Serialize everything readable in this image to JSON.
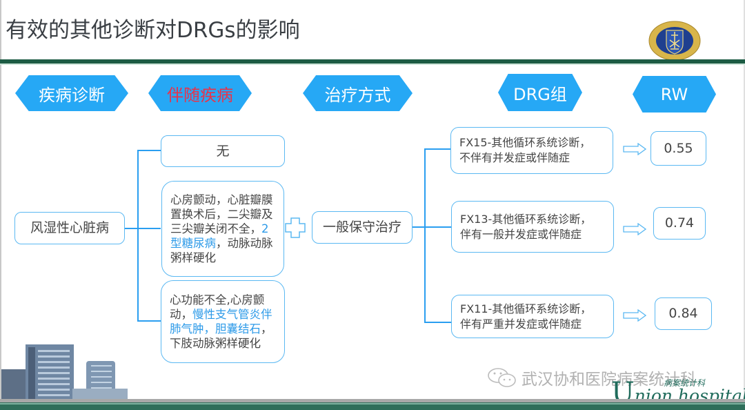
{
  "title": "有效的其他诊断对DRGs的影响",
  "headers": {
    "disease_diagnosis": "疾病诊断",
    "comorbidity": "伴随疾病",
    "treatment": "治疗方式",
    "drg_group": "DRG组",
    "rw": "RW"
  },
  "colors": {
    "header_fill": "#26a8f5",
    "comorbidity_header_text": "#e8334a",
    "connector": "#2a9ef0",
    "box_border": "#5ab8f2",
    "highlight_text": "#2c9ae8",
    "title_rule": "#1d5c44"
  },
  "diagnosis": "风湿性心脏病",
  "comorbidities": [
    {
      "segments": [
        {
          "text": "无",
          "hl": false
        }
      ]
    },
    {
      "segments": [
        {
          "text": "心房颤动，心脏瓣膜置换术后，二尖瓣及三尖瓣关闭不全，",
          "hl": false
        },
        {
          "text": "2型糖尿病",
          "hl": true
        },
        {
          "text": "，动脉动脉粥样硬化",
          "hl": false
        }
      ]
    },
    {
      "segments": [
        {
          "text": "心功能不全,心房颤动，",
          "hl": false
        },
        {
          "text": "慢性支气管炎伴肺气肿，胆囊结石",
          "hl": true
        },
        {
          "text": "，下肢动脉粥样硬化",
          "hl": false
        }
      ]
    }
  ],
  "treatment": "一般保守治疗",
  "drg_groups": [
    {
      "line1": "FX15-其他循环系统诊断，",
      "line2": "不伴有并发症或伴随症",
      "rw": "0.55"
    },
    {
      "line1": "FX13-其他循环系统诊断，",
      "line2": "伴有一般并发症或伴随症",
      "rw": "0.74"
    },
    {
      "line1": "FX11-其他循环系统诊断，",
      "line2": "伴有严重并发症或伴随症",
      "rw": "0.84"
    }
  ],
  "icons": {
    "logo": "hospital-emblem-icon",
    "arrow": "hollow-right-arrow-icon",
    "plus": "hollow-plus-icon",
    "wechat": "wechat-icon"
  },
  "logo_text": "WUHAN UNION HOSPITAL OF CHINA",
  "watermark": "武汉协和医院病案统计科",
  "footer_brand": {
    "initial": "U",
    "rest": "nion hospital",
    "cn": "病案统计科"
  }
}
